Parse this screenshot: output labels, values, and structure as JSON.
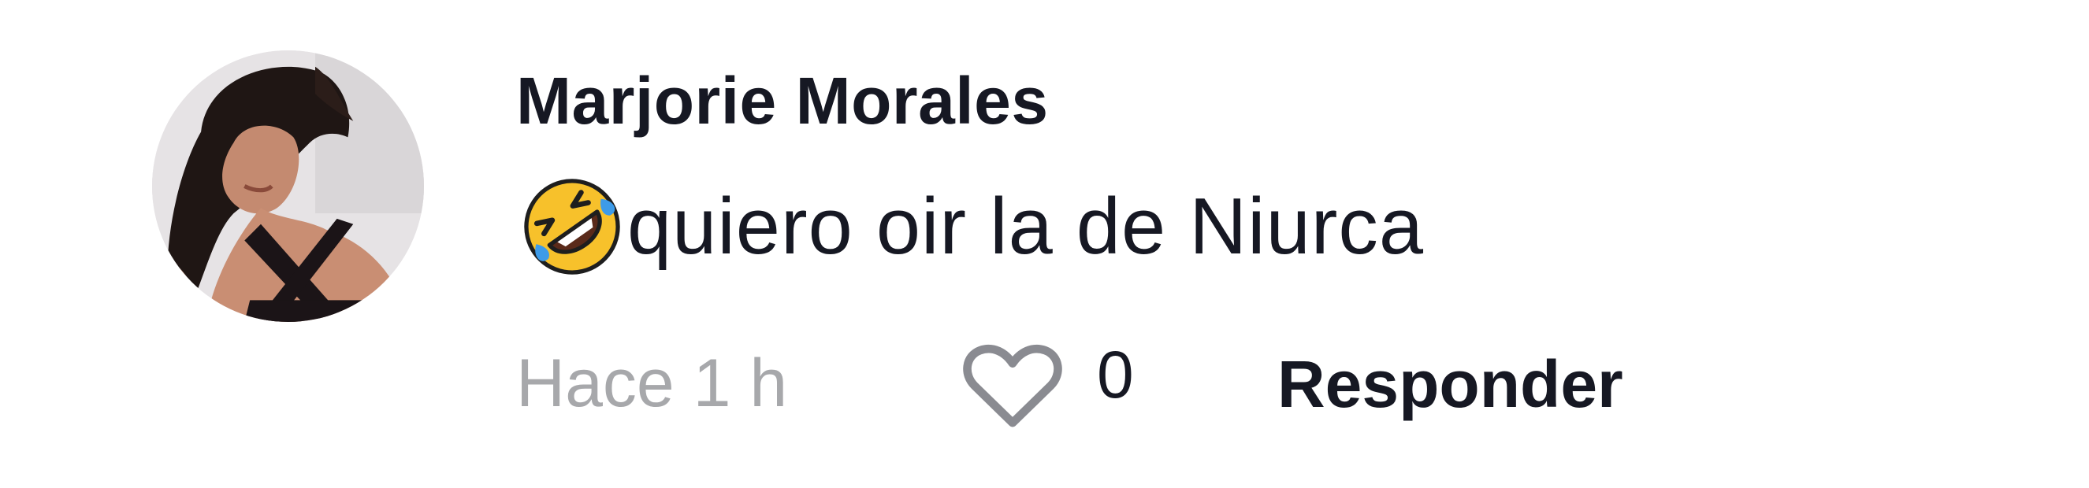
{
  "comment": {
    "author": "Marjorie Morales",
    "emoji": "rolling-on-floor-laughing-emoji",
    "text": "quiero oir la de Niurca",
    "timestamp": "Hace 1 h",
    "likes": "0",
    "reply_label": "Responder"
  },
  "icons": {
    "like": "heart-outline-icon"
  },
  "colors": {
    "text_primary": "#161823",
    "text_secondary": "#a7a8ab",
    "heart_outline": "#8a8b91",
    "emoji_face": "#f7c12b",
    "emoji_tears": "#3d9be9"
  }
}
